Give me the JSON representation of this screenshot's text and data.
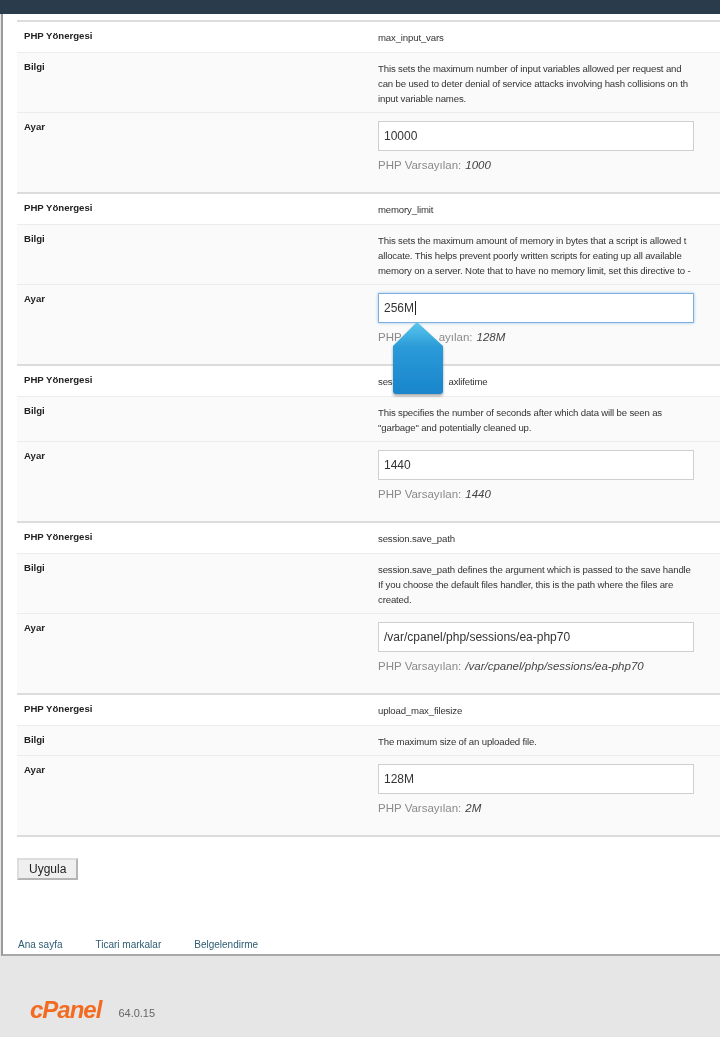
{
  "sections": [
    {
      "labels": {
        "directive": "PHP Yönergesi",
        "info": "Bilgi",
        "setting": "Ayar"
      },
      "name_parts": [
        "max_input_vars"
      ],
      "info_lines": [
        "This sets the maximum number of input variables allowed per request and",
        "can be used to deter denial of service attacks involving hash collisions on th",
        "input variable names."
      ],
      "value": "10000",
      "focused": false,
      "default_label_parts": [
        "PHP Varsayılan:"
      ],
      "default_value": "1000"
    },
    {
      "labels": {
        "directive": "PHP Yönergesi",
        "info": "Bilgi",
        "setting": "Ayar"
      },
      "name_parts": [
        "memory_limit"
      ],
      "info_lines": [
        "This sets the maximum amount of memory in bytes that a script is allowed t",
        "allocate. This helps prevent poorly written scripts for eating up all available",
        "memory on a server. Note that to have no memory limit, set this directive to -"
      ],
      "value": "256M",
      "focused": true,
      "default_label_parts": [
        "PHP",
        "ayılan:"
      ],
      "default_value": "128M"
    },
    {
      "labels": {
        "directive": "PHP Yönergesi",
        "info": "Bilgi",
        "setting": "Ayar"
      },
      "name_parts": [
        "ses",
        "axlifetime"
      ],
      "info_lines": [
        "This specifies the number of seconds after which data will be seen as",
        "\"garbage\" and potentially cleaned up."
      ],
      "value": "1440",
      "focused": false,
      "default_label_parts": [
        "PHP Varsayılan:"
      ],
      "default_value": "1440"
    },
    {
      "labels": {
        "directive": "PHP Yönergesi",
        "info": "Bilgi",
        "setting": "Ayar"
      },
      "name_parts": [
        "session.save_path"
      ],
      "info_lines": [
        "session.save_path defines the argument which is passed to the save handle",
        "If you choose the default files handler, this is the path where the files are",
        "created."
      ],
      "value": "/var/cpanel/php/sessions/ea-php70",
      "focused": false,
      "default_label_parts": [
        "PHP Varsayılan:"
      ],
      "default_value": "/var/cpanel/php/sessions/ea-php70"
    },
    {
      "labels": {
        "directive": "PHP Yönergesi",
        "info": "Bilgi",
        "setting": "Ayar"
      },
      "name_parts": [
        "upload_max_filesize"
      ],
      "info_lines": [
        "The maximum size of an uploaded file."
      ],
      "value": "128M",
      "focused": false,
      "default_label_parts": [
        "PHP Varsayılan:"
      ],
      "default_value": "2M"
    }
  ],
  "apply_button": "Uygula",
  "footer_links": [
    "Ana sayfa",
    "Ticari markalar",
    "Belgelendirme"
  ],
  "footer": {
    "logo": "cPanel",
    "version": "64.0.15"
  }
}
